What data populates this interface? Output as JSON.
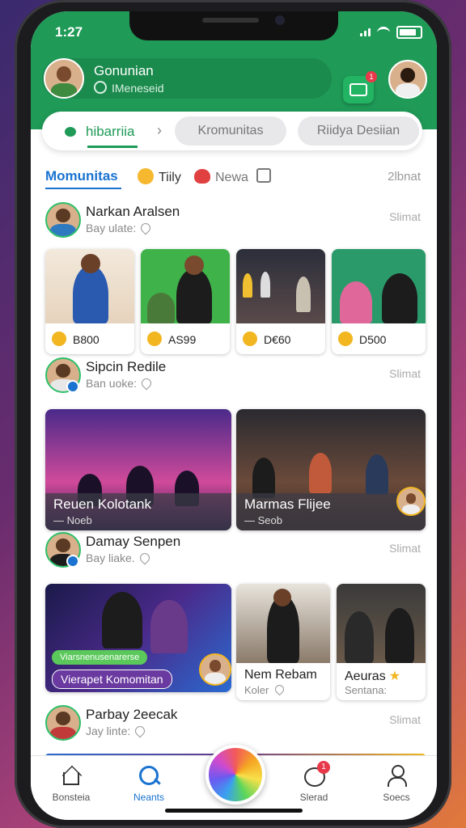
{
  "status": {
    "time": "1:27"
  },
  "profile": {
    "name": "Gonunian",
    "subtitle": "IMeneseid"
  },
  "header_card_badge": "1",
  "top_tabs": {
    "active": "hibarriia",
    "tab2": "Kromunitas",
    "tab3": "Riidya Desiian"
  },
  "sub_tabs": {
    "active": "Momunitas",
    "item1": "Tiily",
    "item2": "Newa",
    "right": "2lbnat"
  },
  "sections": [
    {
      "name": "Narkan Aralsen",
      "sub": "Bay ulate:",
      "right": "Slimat",
      "cards": [
        {
          "price": "B800"
        },
        {
          "price": "AS99"
        },
        {
          "price": "D€60"
        },
        {
          "price": "D500"
        }
      ]
    },
    {
      "name": "Sipcin Redile",
      "sub": "Ban uoke:",
      "right": "Slimat",
      "big": [
        {
          "title": "Reuen Kolotank",
          "meta": "— Noeb"
        },
        {
          "title": "Marmas Flijee",
          "meta": "— Seob"
        }
      ]
    },
    {
      "name": "Damay Senpen",
      "sub": "Bay liake.",
      "right": "Slimat",
      "tags": {
        "tag1": "Viarsnenusenarerse",
        "tag2": "Vierapet Komomitan"
      },
      "small": [
        {
          "title": "Nem Rebam",
          "meta": "Koler"
        },
        {
          "title": "Aeuras",
          "meta": "Sentana:"
        }
      ]
    },
    {
      "name": "Parbay 2eecak",
      "sub": "Jay linte:",
      "right": "Slimat"
    }
  ],
  "nav": {
    "item1": "Bonsteia",
    "item2": "Neants",
    "item4": "Slerad",
    "item5": "Soecs",
    "badge": "1"
  },
  "colors": {
    "brand_green": "#1f9a57",
    "accent_blue": "#1a73d0"
  }
}
